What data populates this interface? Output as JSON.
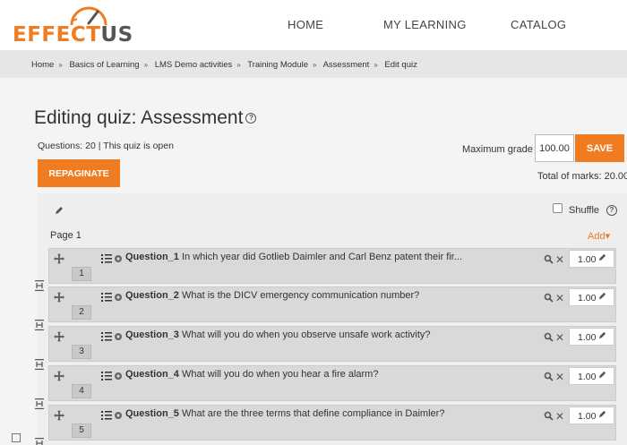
{
  "header": {
    "logo_main": "EFFECT",
    "logo_accent": "US",
    "nav": [
      {
        "label": "HOME"
      },
      {
        "label": "MY LEARNING"
      },
      {
        "label": "CATALOG"
      }
    ]
  },
  "breadcrumb": [
    "Home",
    "Basics of Learning",
    "LMS Demo activities",
    "Training Module",
    "Assessment",
    "Edit quiz"
  ],
  "page": {
    "title": "Editing quiz: Assessment",
    "quiz_info": "Questions: 20 | This quiz is open",
    "max_grade_label": "Maximum grade",
    "max_grade_value": "100.00",
    "save_label": "SAVE",
    "repaginate_label": "REPAGINATE",
    "total_marks": "Total of marks: 20.00",
    "shuffle_label": "Shuffle",
    "page_label": "Page 1",
    "add_label": "Add"
  },
  "questions": [
    {
      "number": "1",
      "name": "Question_1",
      "text": "In which year did Gotlieb Daimler and Carl Benz patent their fir...",
      "mark": "1.00"
    },
    {
      "number": "2",
      "name": "Question_2",
      "text": "What is the DICV emergency communication number?",
      "mark": "1.00"
    },
    {
      "number": "3",
      "name": "Question_3",
      "text": "What will you do when you observe unsafe work activity?",
      "mark": "1.00"
    },
    {
      "number": "4",
      "name": "Question_4",
      "text": "What will you do when you hear a fire alarm?",
      "mark": "1.00"
    },
    {
      "number": "5",
      "name": "Question_5",
      "text": "What are the three terms that define compliance in Daimler?",
      "mark": "1.00"
    }
  ],
  "colors": {
    "accent": "#f07c22"
  },
  "icons": [
    "move-icon",
    "question-type-icon",
    "gear-icon",
    "preview-icon",
    "delete-icon",
    "pencil-icon",
    "help-icon",
    "page-break-icon"
  ]
}
